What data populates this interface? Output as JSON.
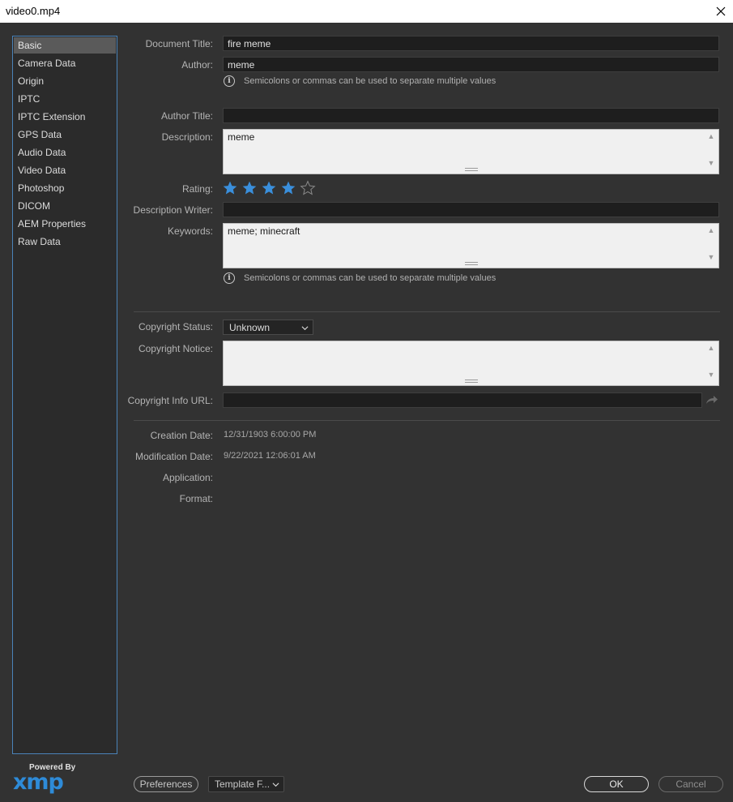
{
  "window": {
    "title": "video0.mp4"
  },
  "sidebar": {
    "items": [
      {
        "label": "Basic",
        "active": true
      },
      {
        "label": "Camera Data"
      },
      {
        "label": "Origin"
      },
      {
        "label": "IPTC"
      },
      {
        "label": "IPTC Extension"
      },
      {
        "label": "GPS Data"
      },
      {
        "label": "Audio Data"
      },
      {
        "label": "Video Data"
      },
      {
        "label": "Photoshop"
      },
      {
        "label": "DICOM"
      },
      {
        "label": "AEM Properties"
      },
      {
        "label": "Raw Data"
      }
    ]
  },
  "branding": {
    "powered_by": "Powered By",
    "xmp": "xmp"
  },
  "form": {
    "document_title": {
      "label": "Document Title:",
      "value": "fire meme"
    },
    "author": {
      "label": "Author:",
      "value": "meme"
    },
    "hint": "Semicolons or commas can be used to separate multiple values",
    "author_title": {
      "label": "Author Title:",
      "value": ""
    },
    "description": {
      "label": "Description:",
      "value": "meme"
    },
    "rating": {
      "label": "Rating:",
      "value": 4,
      "max": 5
    },
    "description_writer": {
      "label": "Description Writer:",
      "value": ""
    },
    "keywords": {
      "label": "Keywords:",
      "value": "meme; minecraft"
    },
    "copyright_status": {
      "label": "Copyright Status:",
      "value": "Unknown"
    },
    "copyright_notice": {
      "label": "Copyright Notice:",
      "value": ""
    },
    "copyright_url": {
      "label": "Copyright Info URL:",
      "value": ""
    },
    "creation_date": {
      "label": "Creation Date:",
      "value": "12/31/1903 6:00:00 PM"
    },
    "modification_date": {
      "label": "Modification Date:",
      "value": "9/22/2021 12:06:01 AM"
    },
    "application": {
      "label": "Application:",
      "value": ""
    },
    "format": {
      "label": "Format:",
      "value": ""
    }
  },
  "footer": {
    "preferences": "Preferences",
    "template": "Template F...",
    "ok": "OK",
    "cancel": "Cancel"
  },
  "colors": {
    "accent": "#3a8fdc",
    "sidebar_border": "#4a83b8",
    "background": "#323232"
  }
}
